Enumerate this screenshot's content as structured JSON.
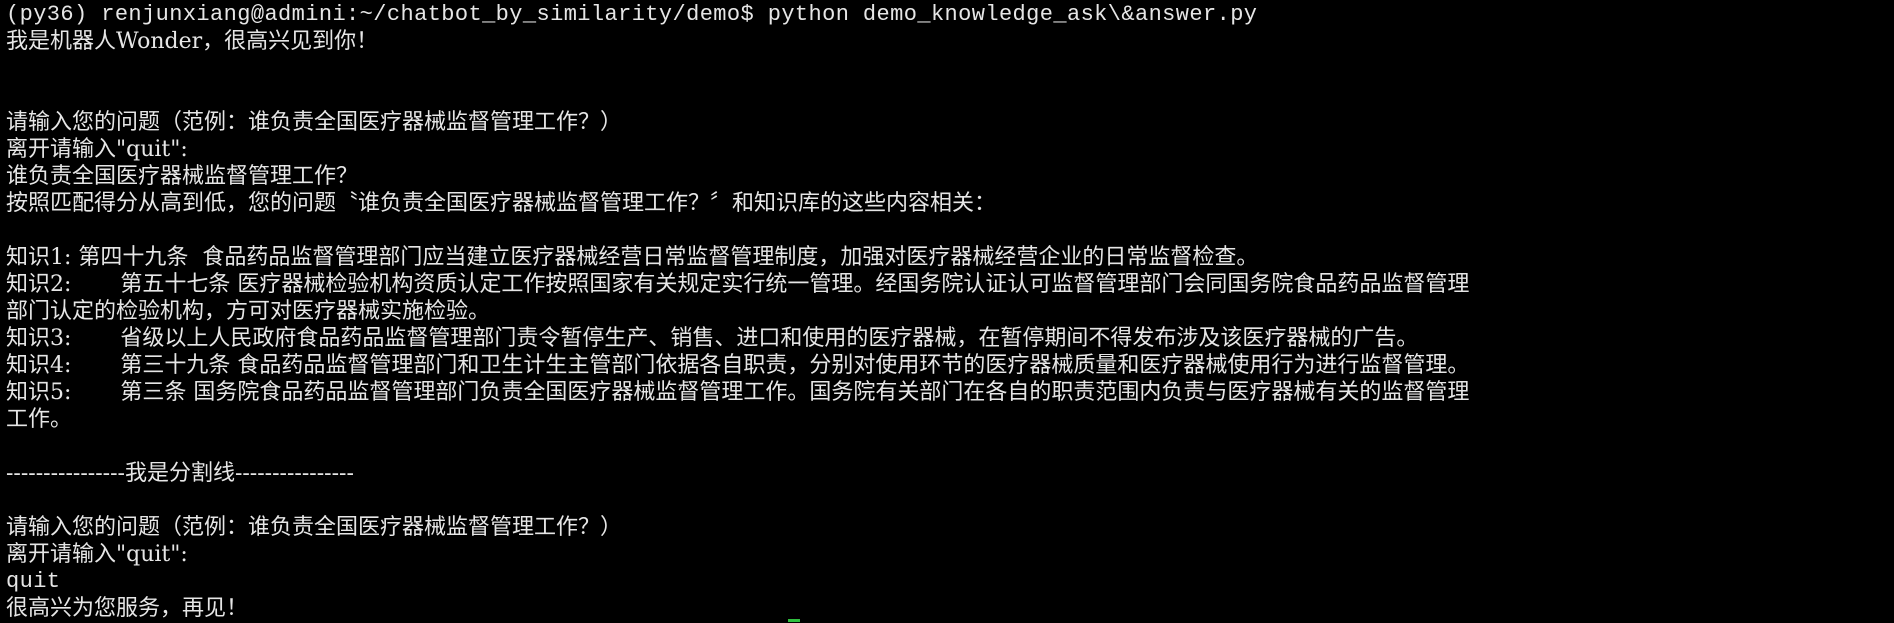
{
  "terminal": {
    "prompt_line": "(py36) renjunxiang@admini:~/chatbot_by_similarity/demo$ python demo_knowledge_ask\\&answer.py",
    "greeting": "我是机器人Wonder，很高兴见到你！",
    "session1": {
      "ask_prompt": "请输入您的问题（范例：谁负责全国医疗器械监督管理工作？）",
      "quit_hint": "离开请输入\"quit\":",
      "user_input": "谁负责全国医疗器械监督管理工作？",
      "result_intro": "按照匹配得分从高到低，您的问题〝谁负责全国医疗器械监督管理工作？〞和知识库的这些内容相关："
    },
    "knowledge": [
      {
        "label": "知识1:",
        "text": " 第四十九条  食品药品监督管理部门应当建立医疗器械经营日常监督管理制度，加强对医疗器械经营企业的日常监督检查。"
      },
      {
        "label": "知识2:",
        "text": "       第五十七条 医疗器械检验机构资质认定工作按照国家有关规定实行统一管理。经国务院认证认可监督管理部门会同国务院食品药品监督管理",
        "continuation": "部门认定的检验机构，方可对医疗器械实施检验。"
      },
      {
        "label": "知识3:",
        "text": "       省级以上人民政府食品药品监督管理部门责令暂停生产、销售、进口和使用的医疗器械，在暂停期间不得发布涉及该医疗器械的广告。"
      },
      {
        "label": "知识4:",
        "text": "       第三十九条 食品药品监督管理部门和卫生计生主管部门依据各自职责，分别对使用环节的医疗器械质量和医疗器械使用行为进行监督管理。"
      },
      {
        "label": "知识5:",
        "text": "       第三条 国务院食品药品监督管理部门负责全国医疗器械监督管理工作。国务院有关部门在各自的职责范围内负责与医疗器械有关的监督管理",
        "continuation": "工作。"
      }
    ],
    "separator": "----------------我是分割线----------------",
    "session2": {
      "ask_prompt": "请输入您的问题（范例：谁负责全国医疗器械监督管理工作？）",
      "quit_hint": "离开请输入\"quit\":",
      "user_input": "quit",
      "farewell": "很高兴为您服务，再见！"
    },
    "colors": {
      "background": "#000000",
      "foreground": "#e6e6e6",
      "cursor": "#2fbf3f"
    }
  }
}
